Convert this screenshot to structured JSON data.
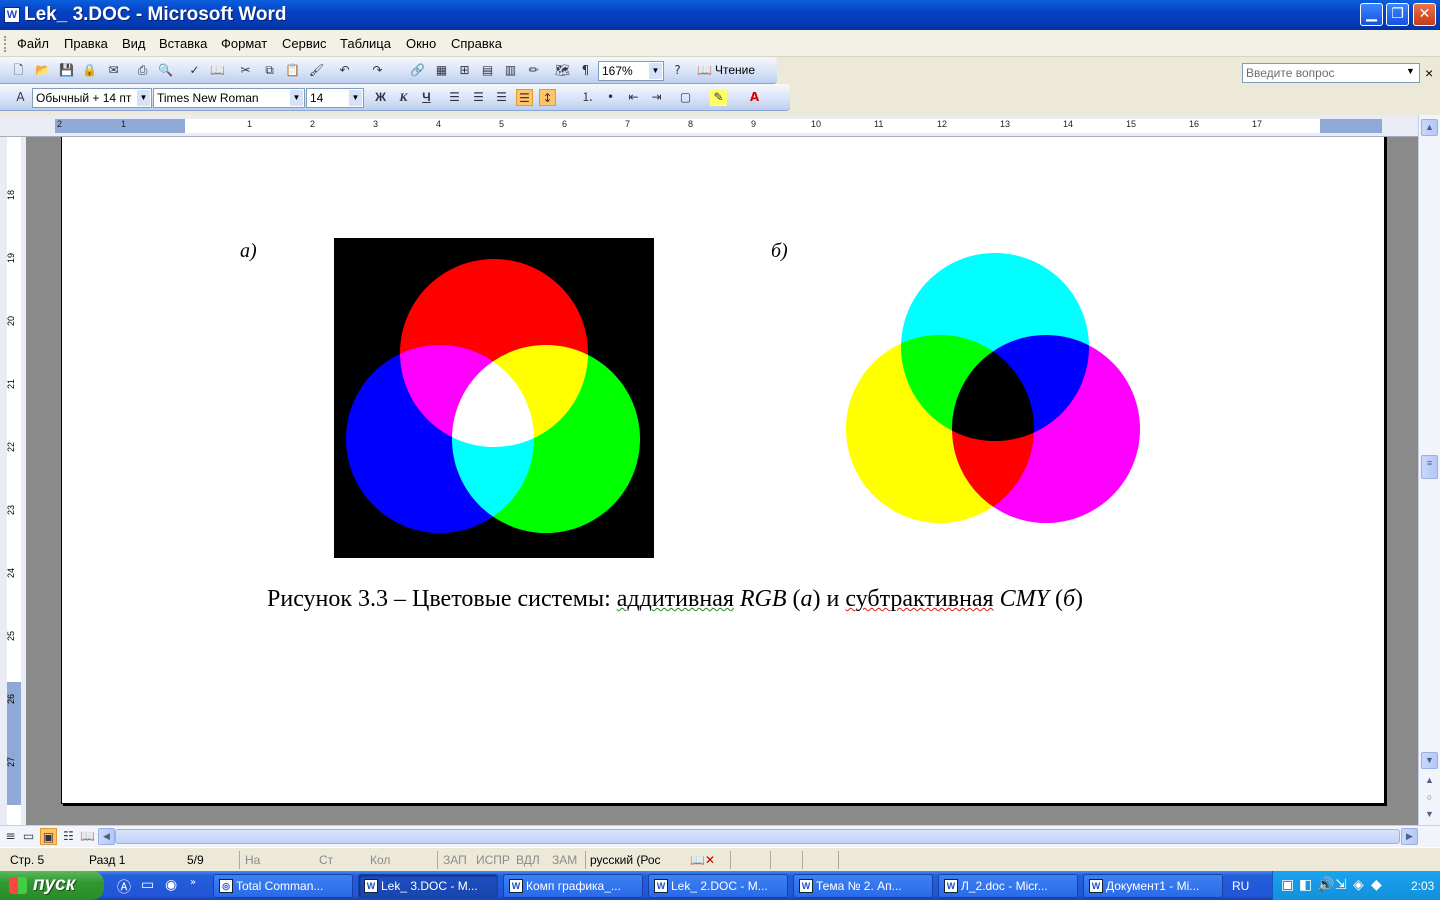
{
  "window": {
    "title": "Lek_ 3.DOC - Microsoft Word",
    "min": "▁",
    "max": "❐",
    "close": "✕"
  },
  "menu": [
    "Файл",
    "Правка",
    "Вид",
    "Вставка",
    "Формат",
    "Сервис",
    "Таблица",
    "Окно",
    "Справка"
  ],
  "ask_placeholder": "Введите вопрос",
  "toolbar": {
    "zoom": "167%",
    "reading": "Чтение"
  },
  "format": {
    "style": "Обычный + 14 пт",
    "font": "Times New Roman",
    "size": "14",
    "bold": "Ж",
    "italic": "К",
    "underline": "Ч"
  },
  "ruler_h": [
    "2",
    "1",
    "1",
    "2",
    "3",
    "4",
    "5",
    "6",
    "7",
    "8",
    "9",
    "10",
    "11",
    "12",
    "13",
    "14",
    "15",
    "16",
    "17"
  ],
  "ruler_v": [
    "18",
    "19",
    "20",
    "21",
    "22",
    "23",
    "24",
    "25",
    "26",
    "27"
  ],
  "ruler_corner": "L",
  "labels": {
    "a": "а)",
    "b": "б)"
  },
  "caption": {
    "p1": "Рисунок 3.3 – Цветовые системы: ",
    "p2": "аддитивная",
    "p3": " ",
    "p4": "RGB",
    "p5": " (",
    "p6": "а",
    "p7": ") и ",
    "p8": "субтрактивная",
    "p9": " ",
    "p10": "CMY",
    "p11": " (",
    "p12": "б",
    "p13": ")"
  },
  "colors": {
    "red": "#ff0000",
    "green": "#00ff00",
    "blue": "#0000ff",
    "cyan": "#00ffff",
    "magenta": "#ff00ff",
    "yellow": "#ffff00",
    "black": "#000000",
    "white": "#ffffff"
  },
  "status": {
    "page": "Стр. 5",
    "section": "Разд 1",
    "pages": "5/9",
    "at": "На",
    "line": "Ст",
    "col": "Кол",
    "rec": "ЗАП",
    "trk": "ИСПР",
    "ext": "ВДЛ",
    "ovr": "ЗАМ",
    "lang": "русский (Рос"
  },
  "taskbar": {
    "start": "пуск",
    "tasks": [
      "Total Comman...",
      "Lek_ 3.DOC - M...",
      "Комп графика_...",
      "Lek_ 2.DOC - M...",
      "Тема № 2. Ап...",
      "Л_2.doc - Micr...",
      "Документ1 - Mi..."
    ],
    "lang": "RU",
    "clock": "2:03"
  }
}
